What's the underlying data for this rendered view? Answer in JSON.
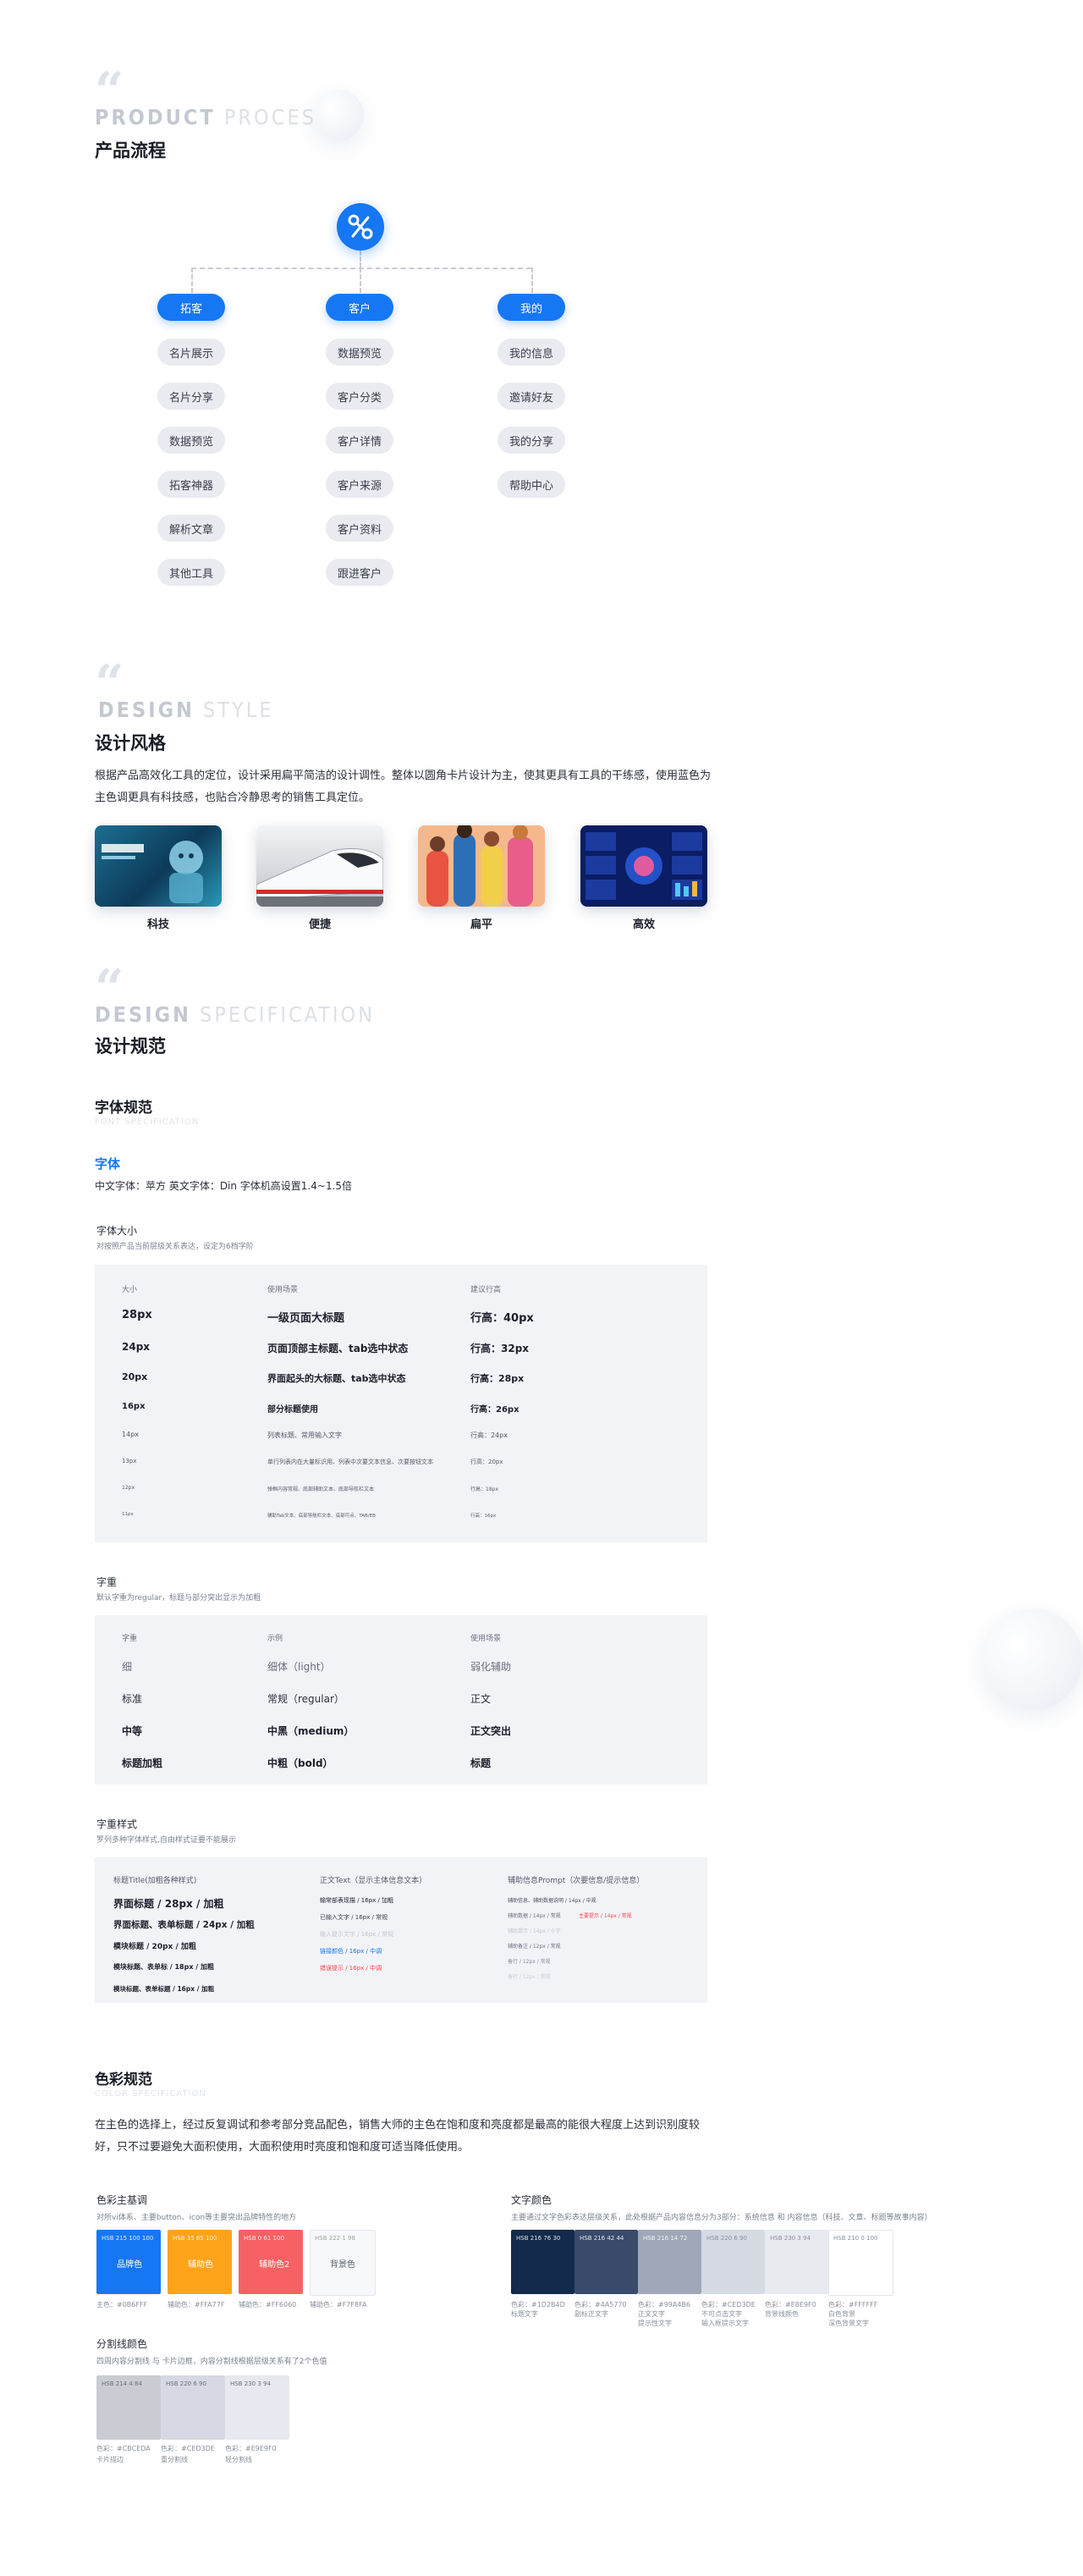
{
  "process": {
    "en_bold": "PRODUCT",
    "en_light": "PROCESS",
    "cn_title": "产品流程",
    "columns": [
      {
        "head": "拓客",
        "items": [
          "名片展示",
          "名片分享",
          "数据预览",
          "拓客神器",
          "解析文章",
          "其他工具"
        ]
      },
      {
        "head": "客户",
        "items": [
          "数据预览",
          "客户分类",
          "客户详情",
          "客户来源",
          "客户资料",
          "跟进客户"
        ]
      },
      {
        "head": "我的",
        "items": [
          "我的信息",
          "邀请好友",
          "我的分享",
          "帮助中心"
        ]
      }
    ]
  },
  "design_style": {
    "en_bold": "DESIGN",
    "en_light": "STYLE",
    "cn_title": "设计风格",
    "description": "根据产品高效化工具的定位，设计采用扁平简洁的设计调性。整体以圆角卡片设计为主，使其更具有工具的干练感，使用蓝色为主色调更具有科技感，也贴合冷静思考的销售工具定位。",
    "cards": [
      {
        "label": "科技",
        "icon": "tech-robot-image"
      },
      {
        "label": "便捷",
        "icon": "highspeed-train-image"
      },
      {
        "label": "扁平",
        "icon": "flat-illustration-image"
      },
      {
        "label": "高效",
        "icon": "dashboard-image"
      }
    ]
  },
  "spec": {
    "en_bold": "DESIGN",
    "en_light": "SPECIFICATION",
    "cn_title": "设计规范"
  },
  "font_spec": {
    "title": "字体规范",
    "title_en": "FONT SPECIFICATION",
    "font_label": "字体",
    "font_desc": "中文字体：苹方  英文字体：Din  字体机高设置1.4~1.5倍",
    "size_title": "字体大小",
    "size_note": "对按照产品当前层级关系表达，设定为6档字阶",
    "size_table": {
      "headers": [
        "大小",
        "使用场景",
        "建议行高"
      ],
      "rows": [
        [
          "28px",
          "一级页面大标题",
          "行高：40px"
        ],
        [
          "24px",
          "页面顶部主标题、tab选中状态",
          "行高：32px"
        ],
        [
          "20px",
          "界面起头的大标题、tab选中状态",
          "行高：28px"
        ],
        [
          "16px",
          "部分标题使用",
          "行高：26px"
        ],
        [
          "14px",
          "列表标题、常用输入文字",
          "行高：24px"
        ],
        [
          "13px",
          "单行列表内在大量标识用、列表中次要文本信息、次要按钮文本",
          "行高：20px"
        ],
        [
          "12px",
          "弹框内容常规、底部辅助文本、底部导航栏文本",
          "行高：18px"
        ],
        [
          "11px",
          "辅助Tab文本、底部导航栏文本、底部可点、TAB/EB",
          "行高：16px"
        ]
      ]
    },
    "weight_title": "字重",
    "weight_note": "默认字重为regular，标题与部分突出显示为加粗",
    "weight_table": {
      "headers": [
        "字重",
        "示例",
        "使用场景"
      ],
      "rows": [
        [
          "细",
          "细体（light）",
          "弱化辅助"
        ],
        [
          "标准",
          "常规（regular）",
          "正文"
        ],
        [
          "中等",
          "中黑（medium）",
          "正文突出"
        ],
        [
          "标题加粗",
          "中粗（bold）",
          "标题"
        ]
      ]
    },
    "style_title": "字重样式",
    "style_note": "罗列多种字体样式,自由样式证要不能展示",
    "style_cols": [
      {
        "head": "标题Title(加粗各种样式)",
        "items": [
          "界面标题 / 28px / 加粗",
          "界面标题、表单标题 / 24px / 加粗",
          "模块标题 / 20px / 加粗",
          "模块标题、表单标 / 18px / 加粗",
          "模块标题、表单标题 / 16px / 加粗"
        ]
      },
      {
        "head": "正文Text（显示主体信息文本）",
        "items": [
          "输常部表现描 / 16px / 加粗",
          "已输入文字 / 16px / 常规",
          "输入提示文字 / 16px / 常规",
          "链接颜色 / 16px / 中调",
          "错误提示 / 16px / 中调"
        ]
      },
      {
        "head": "辅助信息Prompt（次要信息/提示信息）",
        "items": [
          "辅助信息、辅助数据说明 / 14px / 中规",
          "辅助数据 / 14px / 常规",
          "辅助提示 / 14px / 小字",
          "辅助备注 / 12px / 常规",
          "备行 / 12px / 常规",
          "备行 / 12px / 常规"
        ],
        "red_extra": "主要提示 / 14px / 常规"
      }
    ]
  },
  "color_spec": {
    "title": "色彩规范",
    "title_en": "COLOR SPECIFICATION",
    "desc": "在主色的选择上，经过反复调试和参考部分竞品配色，销售大师的主色在饱和度和亮度都是最高的能很大程度上达到识别度较好，只不过要避免大面积使用，大面积使用时亮度和饱和度可适当降低使用。",
    "main": {
      "title": "色彩主基调",
      "note": "对所vi体系、主要button、icon等主要突出品牌特性的地方",
      "swatches": [
        {
          "name": "品牌色",
          "hsb": "HSB 215 100 100",
          "color": "#1677f4",
          "cap": "主色：#0B6FFF"
        },
        {
          "name": "辅助色",
          "hsb": "HSB 35 85 100",
          "color": "#ffa31a",
          "cap": "辅助色：#FFA77F"
        },
        {
          "name": "辅助色2",
          "hsb": "HSB 0 61 100",
          "color": "#f86164",
          "cap": "辅助色：#FF6060"
        },
        {
          "name": "背景色",
          "hsb": "HSB 222 1 98",
          "color": "#f7f8fa",
          "cap": "辅助色：#F7F8FA"
        }
      ]
    },
    "text": {
      "title": "文字颜色",
      "note": "主要通过文字色彩表达层级关系，此处根据产品内容信息分为3部分：系统信息 和 内容信息（科技、文章、标题等故事内容）",
      "swatches": [
        {
          "hsb": "HSB 216 76 30",
          "color": "#132a4b",
          "cap": [
            "色彩：#1D2B4D",
            "标题文字"
          ]
        },
        {
          "hsb": "HSB 216 42 44",
          "color": "#3a4a6b",
          "cap": [
            "色彩：#4A5770",
            "副标正文字"
          ]
        },
        {
          "hsb": "HSB 216 14 72",
          "color": "#9ea8b8",
          "cap": [
            "色彩：#99A4B6",
            "正文文字",
            "提示性文字"
          ]
        },
        {
          "hsb": "HSB 220 6 90",
          "color": "#d6dae3",
          "cap": [
            "色彩：#CED3DE",
            "不可点击文字",
            "输入框提示文字"
          ]
        },
        {
          "hsb": "HSB 230 3 94",
          "color": "#e8eaf0",
          "cap": [
            "色彩：#E8E9F0",
            "背景线颜色"
          ]
        },
        {
          "hsb": "HSB 210 0 100",
          "color": "#ffffff",
          "cap": [
            "色彩：#FFFFFF",
            "白色背景",
            "深色背景文字"
          ]
        }
      ]
    },
    "divider": {
      "title": "分割线颜色",
      "note": "四周内容分割线 与 卡片边框，内容分割线根据层级关系有了2个色值",
      "swatches": [
        {
          "hsb": "HSB 214 4 84",
          "color": "#c9ccd3",
          "cap": [
            "色彩：#CBCEDA",
            "卡片描边"
          ]
        },
        {
          "hsb": "HSB 220 6 90",
          "color": "#d6d9e3",
          "cap": [
            "色彩：#CED3DE",
            "重分割线"
          ]
        },
        {
          "hsb": "HSB 230 3 94",
          "color": "#e7e9f0",
          "cap": [
            "色彩：#E9E9F0",
            "轻分割线"
          ]
        }
      ]
    }
  }
}
